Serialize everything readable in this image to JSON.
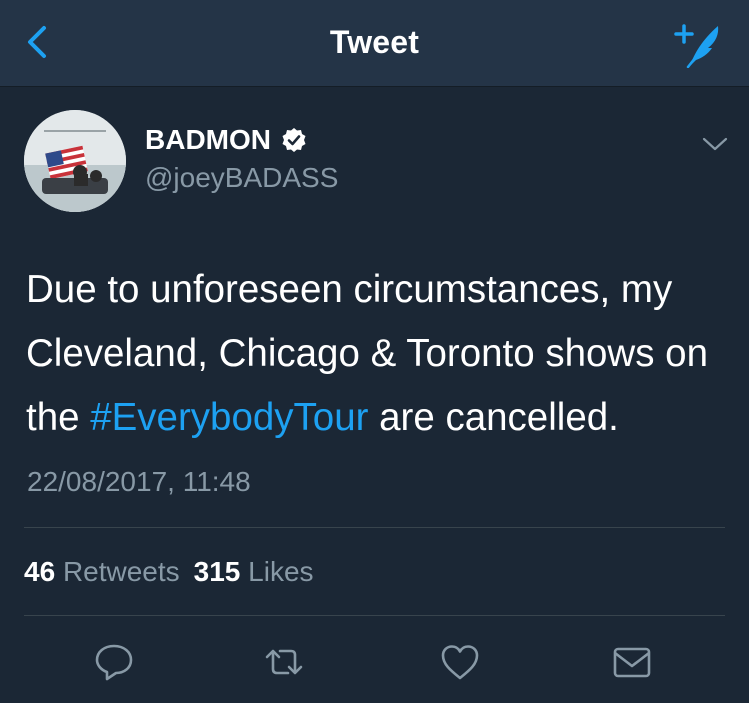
{
  "nav": {
    "title": "Tweet"
  },
  "author": {
    "name": "BADMON",
    "handle": "@joeyBADASS",
    "verified": true
  },
  "tweet": {
    "text_before": "Due to unforeseen circumstances, my Cleveland, Chicago & Toronto shows on the ",
    "hashtag": "#EverybodyTour",
    "text_after": " are cancelled.",
    "timestamp": "22/08/2017, 11:48"
  },
  "stats": {
    "retweets_count": "46",
    "retweets_label": "Retweets",
    "likes_count": "315",
    "likes_label": "Likes"
  },
  "icons": {
    "back": "chevron-left-icon",
    "compose": "feather-plus-icon",
    "verified": "verified-badge-icon",
    "caret": "chevron-down-icon",
    "reply": "speech-bubble-icon",
    "retweet": "retweet-arrows-icon",
    "like": "heart-icon",
    "message": "envelope-icon"
  },
  "colors": {
    "background": "#1b2735",
    "navbar": "#243447",
    "accent": "#1da1f2",
    "secondary_text": "#8899a6",
    "divider": "#38444d"
  }
}
